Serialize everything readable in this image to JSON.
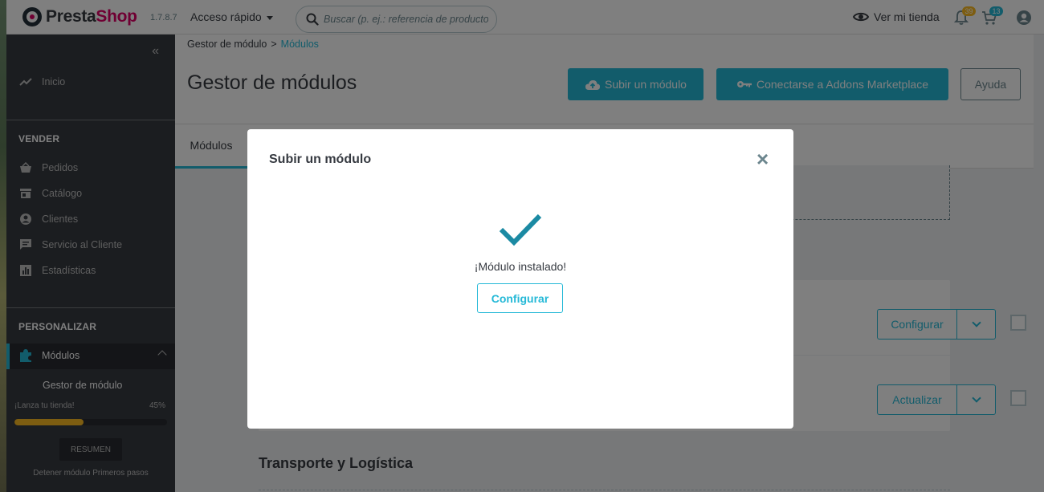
{
  "header": {
    "logo_prefix": "Presta",
    "logo_accent": "Shop",
    "version": "1.7.8.7",
    "quick_access": "Acceso rápido",
    "search_placeholder": "Buscar (p. ej.: referencia de producto,",
    "view_store": "Ver mi tienda",
    "notifications_count": "39",
    "orders_count": "13"
  },
  "sidebar": {
    "home": "Inicio",
    "sell_heading": "VENDER",
    "sell_items": [
      "Pedidos",
      "Catálogo",
      "Clientes",
      "Servicio al Cliente",
      "Estadísticas"
    ],
    "customize_heading": "PERSONALIZAR",
    "modules": "Módulos",
    "module_manager": "Gestor de módulo",
    "launch_label": "¡Lanza tu tienda!",
    "launch_percent_text": "45%",
    "launch_progress": 0.45,
    "summary_button": "RESUMEN",
    "stop_onboarding": "Detener módulo Primeros pasos"
  },
  "page": {
    "breadcrumb_parent": "Gestor de módulo",
    "breadcrumb_current": "Módulos",
    "title": "Gestor de módulos",
    "upload_button": "Subir un módulo",
    "connect_button": "Conectarse a Addons Marketplace",
    "help_button": "Ayuda",
    "tab_modules": "Módulos",
    "row1_action": "Configurar",
    "row2_action": "Actualizar",
    "section_title": "Transporte y Logística"
  },
  "modal": {
    "title": "Subir un módulo",
    "close": "×",
    "message": "¡Módulo instalado!",
    "configure_button": "Configurar"
  },
  "colors": {
    "primary": "#25b9d7",
    "sidebar_bg": "#363a41",
    "badge_yellow": "#fbbb22",
    "badge_blue": "#25b9d7",
    "checkmark": "#1b8aa3"
  }
}
